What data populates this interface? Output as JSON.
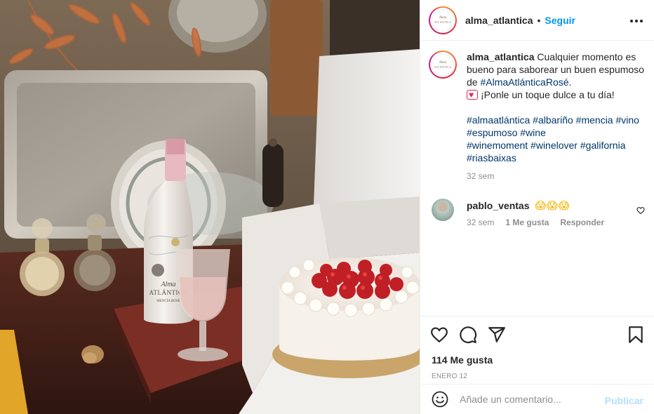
{
  "post": {
    "username": "alma_atlantica",
    "separator": "•",
    "follow_label": "Seguir",
    "more_label": "•••",
    "avatar_text_line1": "Alma",
    "avatar_text_line2": "ATLÁNTICA"
  },
  "caption": {
    "username": "alma_atlantica",
    "text_part1": "Cualquier momento es bueno para saborear un buen espumoso de ",
    "hashtag_main": "#AlmaAtlánticaRosé",
    "text_part2": ".",
    "text_part3": "¡Ponle un toque dulce a tu día!",
    "hashtags": [
      "#almaatlántica",
      "#albariño",
      "#mencia",
      "#vino",
      "#espumoso",
      "#wine",
      "#winemoment",
      "#winelover",
      "#galifornia",
      "#riasbaixas"
    ],
    "time": "32 sem"
  },
  "comment": {
    "username": "pablo_ventas",
    "text": "😱😱😱",
    "time": "32 sem",
    "likes": "1 Me gusta",
    "reply": "Responder"
  },
  "stats": {
    "likes": "114 Me gusta",
    "date": "ENERO 12"
  },
  "add_comment": {
    "placeholder": "Añade un comentario...",
    "publish_label": "Publicar"
  },
  "photo": {
    "bottle_label_line1": "Alma",
    "bottle_label_line2": "ATLÁNTICA",
    "bottle_label_line3": "MENCÍA ROSÉ"
  },
  "colors": {
    "link_blue": "#0095f6",
    "hashtag_blue": "#00376b",
    "muted_gray": "#8e8e8e",
    "publish_disabled": "#b2dffc"
  }
}
